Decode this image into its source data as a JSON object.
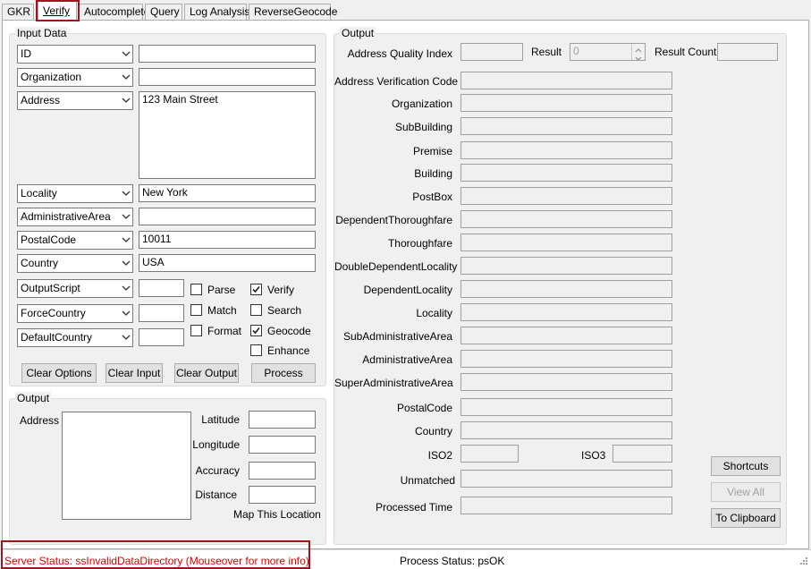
{
  "tabs": [
    "GKR",
    "Verify",
    "Autocomplete",
    "Query",
    "Log Analysis",
    "ReverseGeocode"
  ],
  "input_data": {
    "title": "Input Data",
    "fields": [
      {
        "combo": "ID",
        "value": ""
      },
      {
        "combo": "Organization",
        "value": ""
      },
      {
        "combo": "Address",
        "value": "123 Main Street"
      },
      {
        "combo": "Locality",
        "value": "New York"
      },
      {
        "combo": "AdministrativeArea",
        "value": ""
      },
      {
        "combo": "PostalCode",
        "value": "10011"
      },
      {
        "combo": "Country",
        "value": "USA"
      },
      {
        "combo": "OutputScript",
        "value": ""
      },
      {
        "combo": "ForceCountry",
        "value": ""
      },
      {
        "combo": "DefaultCountry",
        "value": ""
      }
    ],
    "checkboxes": [
      {
        "label": "Parse",
        "checked": false
      },
      {
        "label": "Match",
        "checked": false
      },
      {
        "label": "Format",
        "checked": false
      },
      {
        "label": "Verify",
        "checked": true
      },
      {
        "label": "Search",
        "checked": false
      },
      {
        "label": "Geocode",
        "checked": true
      },
      {
        "label": "Enhance",
        "checked": false
      }
    ],
    "buttons": {
      "clear_options": "Clear Options",
      "clear_input": "Clear Input",
      "clear_output": "Clear Output",
      "process": "Process"
    }
  },
  "output_small": {
    "title": "Output",
    "address_label": "Address",
    "latitude": "Latitude",
    "longitude": "Longitude",
    "accuracy": "Accuracy",
    "distance": "Distance",
    "map_link": "Map This Location"
  },
  "output": {
    "title": "Output",
    "aqi_label": "Address Quality Index",
    "result_label": "Result",
    "result_value": "0",
    "result_count_label": "Result Count",
    "fields": [
      "Address Verification Code",
      "Organization",
      "SubBuilding",
      "Premise",
      "Building",
      "PostBox",
      "DependentThoroughfare",
      "Thoroughfare",
      "DoubleDependentLocality",
      "DependentLocality",
      "Locality",
      "SubAdministrativeArea",
      "AdministrativeArea",
      "SuperAdministrativeArea",
      "PostalCode",
      "Country"
    ],
    "iso2": "ISO2",
    "iso3": "ISO3",
    "unmatched": "Unmatched",
    "processed_time": "Processed Time",
    "shortcuts": "Shortcuts",
    "view_all": "View All",
    "to_clipboard": "To Clipboard"
  },
  "status": {
    "server": "Server Status: ssInvalidDataDirectory (Mouseover for more info)",
    "process": "Process Status: psOK",
    "server_color": "#e00000",
    "highlight_color": "#a0121c"
  }
}
